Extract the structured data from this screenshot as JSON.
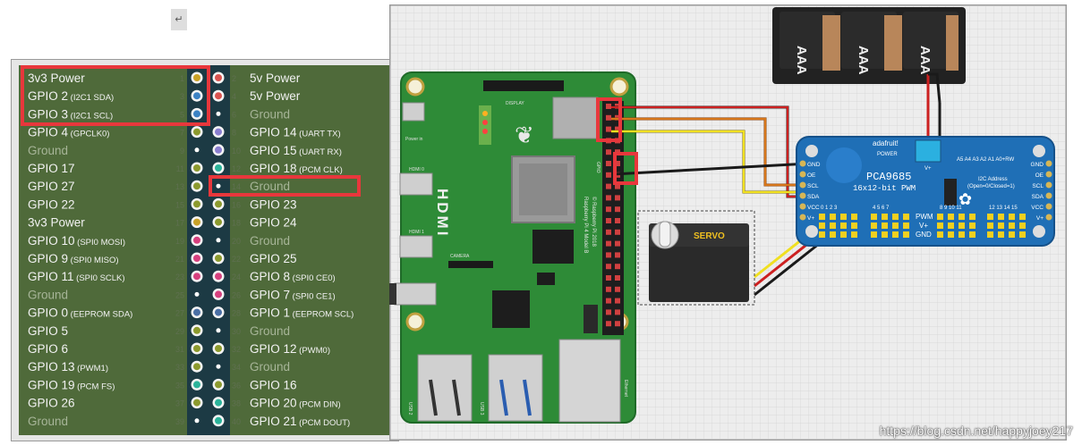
{
  "header": {
    "cursor_glyph": "↵"
  },
  "pinout": {
    "left": [
      {
        "num": "1",
        "name": "3v3 Power",
        "sub": "",
        "type": "power"
      },
      {
        "num": "3",
        "name": "GPIO 2",
        "sub": "(I2C1 SDA)",
        "type": "i2c"
      },
      {
        "num": "5",
        "name": "GPIO 3",
        "sub": "(I2C1 SCL)",
        "type": "i2c"
      },
      {
        "num": "7",
        "name": "GPIO 4",
        "sub": "(GPCLK0)",
        "type": "gpio"
      },
      {
        "num": "9",
        "name": "Ground",
        "sub": "",
        "type": "ground"
      },
      {
        "num": "11",
        "name": "GPIO 17",
        "sub": "",
        "type": "gpio"
      },
      {
        "num": "13",
        "name": "GPIO 27",
        "sub": "",
        "type": "gpio"
      },
      {
        "num": "15",
        "name": "GPIO 22",
        "sub": "",
        "type": "gpio"
      },
      {
        "num": "17",
        "name": "3v3 Power",
        "sub": "",
        "type": "power"
      },
      {
        "num": "19",
        "name": "GPIO 10",
        "sub": "(SPI0 MOSI)",
        "type": "spi"
      },
      {
        "num": "21",
        "name": "GPIO 9",
        "sub": "(SPI0 MISO)",
        "type": "spi"
      },
      {
        "num": "23",
        "name": "GPIO 11",
        "sub": "(SPI0 SCLK)",
        "type": "spi"
      },
      {
        "num": "25",
        "name": "Ground",
        "sub": "",
        "type": "ground"
      },
      {
        "num": "27",
        "name": "GPIO 0",
        "sub": "(EEPROM SDA)",
        "type": "eeprom"
      },
      {
        "num": "29",
        "name": "GPIO 5",
        "sub": "",
        "type": "gpio"
      },
      {
        "num": "31",
        "name": "GPIO 6",
        "sub": "",
        "type": "gpio"
      },
      {
        "num": "33",
        "name": "GPIO 13",
        "sub": "(PWM1)",
        "type": "gpio"
      },
      {
        "num": "35",
        "name": "GPIO 19",
        "sub": "(PCM FS)",
        "type": "pcm"
      },
      {
        "num": "37",
        "name": "GPIO 26",
        "sub": "",
        "type": "gpio"
      },
      {
        "num": "39",
        "name": "Ground",
        "sub": "",
        "type": "ground"
      }
    ],
    "right": [
      {
        "num": "2",
        "name": "5v Power",
        "sub": "",
        "type": "5v"
      },
      {
        "num": "4",
        "name": "5v Power",
        "sub": "",
        "type": "5v"
      },
      {
        "num": "6",
        "name": "Ground",
        "sub": "",
        "type": "ground"
      },
      {
        "num": "8",
        "name": "GPIO 14",
        "sub": "(UART TX)",
        "type": "uart"
      },
      {
        "num": "10",
        "name": "GPIO 15",
        "sub": "(UART RX)",
        "type": "uart"
      },
      {
        "num": "12",
        "name": "GPIO 18",
        "sub": "(PCM CLK)",
        "type": "pcm"
      },
      {
        "num": "14",
        "name": "Ground",
        "sub": "",
        "type": "ground"
      },
      {
        "num": "16",
        "name": "GPIO 23",
        "sub": "",
        "type": "gpio"
      },
      {
        "num": "18",
        "name": "GPIO 24",
        "sub": "",
        "type": "gpio"
      },
      {
        "num": "20",
        "name": "Ground",
        "sub": "",
        "type": "ground"
      },
      {
        "num": "22",
        "name": "GPIO 25",
        "sub": "",
        "type": "gpio"
      },
      {
        "num": "24",
        "name": "GPIO 8",
        "sub": "(SPI0 CE0)",
        "type": "spi"
      },
      {
        "num": "26",
        "name": "GPIO 7",
        "sub": "(SPI0 CE1)",
        "type": "spi"
      },
      {
        "num": "28",
        "name": "GPIO 1",
        "sub": "(EEPROM SCL)",
        "type": "eeprom"
      },
      {
        "num": "30",
        "name": "Ground",
        "sub": "",
        "type": "ground"
      },
      {
        "num": "32",
        "name": "GPIO 12",
        "sub": "(PWM0)",
        "type": "gpio"
      },
      {
        "num": "34",
        "name": "Ground",
        "sub": "",
        "type": "ground"
      },
      {
        "num": "36",
        "name": "GPIO 16",
        "sub": "",
        "type": "gpio"
      },
      {
        "num": "38",
        "name": "GPIO 20",
        "sub": "(PCM DIN)",
        "type": "pcm"
      },
      {
        "num": "40",
        "name": "GPIO 21",
        "sub": "(PCM DOUT)",
        "type": "pcm"
      }
    ]
  },
  "pin_colors": {
    "power": "#c9a227",
    "5v": "#d9534f",
    "ground": "#222222",
    "gpio": "#8c9a2e",
    "i2c": "#3b82c4",
    "spi": "#d6407e",
    "uart": "#8a7fd0",
    "pcm": "#2bb39a",
    "eeprom": "#4a6fa5"
  },
  "highlights": [
    "3v3 / SDA / SCL pins",
    "Ground pin 14"
  ],
  "board": {
    "hdmi_label": "HDMI",
    "model_text": "Raspberry Pi 4 Model B",
    "copyright_text": "© Raspberry Pi 2018",
    "display_label": "DISPLAY",
    "camera_label": "CAMERA",
    "power_label": "Power in",
    "hdmi0_label": "HDMI 0",
    "hdmi1_label": "HDMI 1",
    "usb2_label": "USB 2",
    "usb3_label": "USB 3",
    "ethernet_label": "Ethernet",
    "gpio_label": "GPIO"
  },
  "battery": {
    "cells": [
      "AAA",
      "AAA",
      "AAA"
    ]
  },
  "servo": {
    "label": "SERVO"
  },
  "pca": {
    "title": "PCA9685",
    "subtitle": "16x12-bit PWM",
    "brand": "adafruit!",
    "power_label": "POWER",
    "vplus": "V+",
    "i2c_addr_line1": "I2C Address",
    "i2c_addr_line2": "(Open=0/Closed=1)",
    "addr_pins": "A5 A4 A3 A2 A1 A0+RW",
    "left_pins": [
      "GND",
      "OE",
      "SCL",
      "SDA",
      "VCC",
      "V+"
    ],
    "right_pins": [
      "GND",
      "OE",
      "SCL",
      "SDA",
      "VCC",
      "V+"
    ],
    "channel_groups": [
      "0 1 2 3",
      "4 5 6 7",
      "8 9 10 11",
      "12 13 14 15"
    ],
    "pwm_row": "PWM",
    "vplus_row": "V+",
    "gnd_row": "GND"
  },
  "watermark": "https://blog.csdn.net/happyjoey217",
  "colors": {
    "panel_green": "#4f6a3a",
    "header_strip": "#1c3a44",
    "board_green": "#2e8b37",
    "pca_blue": "#1f6fb6",
    "highlight_red": "#e8373c"
  }
}
